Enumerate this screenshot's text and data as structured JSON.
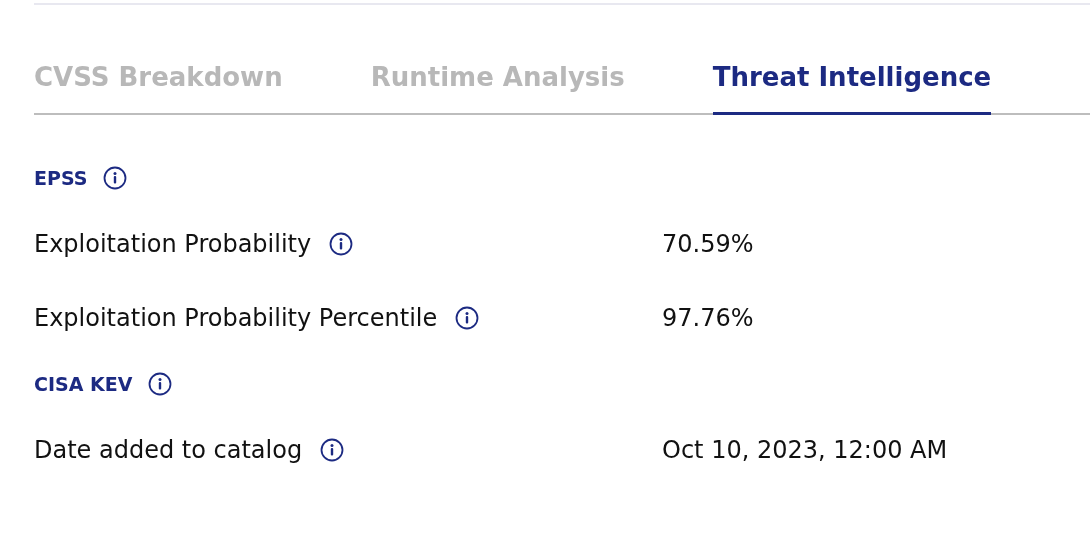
{
  "tabs": [
    {
      "label": "CVSS Breakdown",
      "selected": false
    },
    {
      "label": "Runtime Analysis",
      "selected": false
    },
    {
      "label": "Threat Intelligence",
      "selected": true
    }
  ],
  "sections": [
    {
      "title": "EPSS",
      "rows": [
        {
          "label": "Exploitation Probability",
          "value": "70.59%"
        },
        {
          "label": "Exploitation Probability Percentile",
          "value": "97.76%"
        }
      ]
    },
    {
      "title": "CISA KEV",
      "rows": [
        {
          "label": "Date added to catalog",
          "value": "Oct 10, 2023, 12:00 AM"
        }
      ]
    }
  ]
}
